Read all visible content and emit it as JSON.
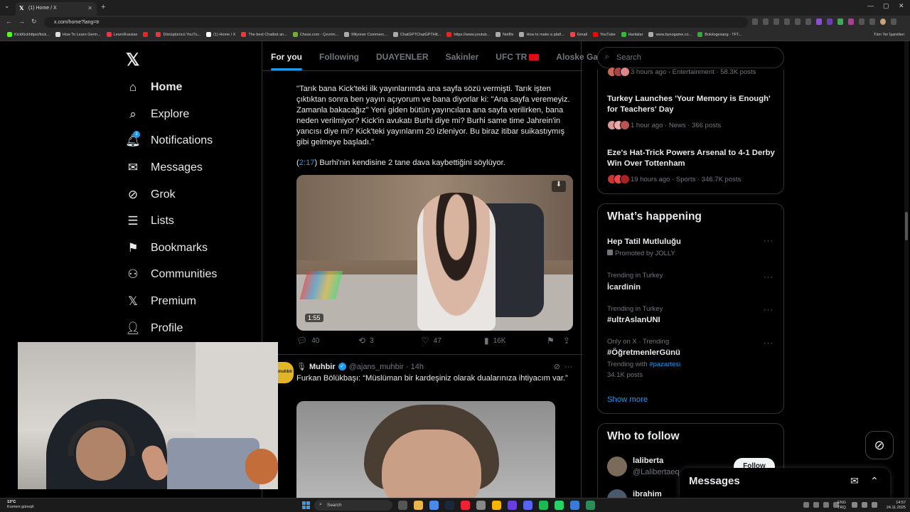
{
  "browser": {
    "tab_title": "(1) Home / X",
    "url": "x.com/home?lang=tr",
    "bookmarks": [
      "KickKickhttps//kick...",
      "How To Learn Germ...",
      "LearnRussian",
      "",
      "Dönüştürücü YouTu...",
      "(1) Home / X",
      "The best Chatbot an...",
      "Chess.com - Çevrim...",
      "Milyoner Commerc...",
      "ChatGPTChatGPTHtt...",
      "https://www.youtub...",
      "Netflix",
      "How to make a platf...",
      "Gmail",
      "YouTube",
      "Haritalar",
      "www.bynogame.co...",
      "Bolologesang - TFT..."
    ],
    "bookmarks_right": "Tüm Yer İşaretleri"
  },
  "sidebar": {
    "items": [
      {
        "label": "Home",
        "icon": "home-icon"
      },
      {
        "label": "Explore",
        "icon": "search-icon"
      },
      {
        "label": "Notifications",
        "icon": "bell-icon"
      },
      {
        "label": "Messages",
        "icon": "envelope-icon"
      },
      {
        "label": "Grok",
        "icon": "grok-icon"
      },
      {
        "label": "Lists",
        "icon": "list-icon"
      },
      {
        "label": "Bookmarks",
        "icon": "bookmark-icon"
      },
      {
        "label": "Communities",
        "icon": "people-icon"
      },
      {
        "label": "Premium",
        "icon": "x-logo-icon"
      },
      {
        "label": "Profile",
        "icon": "person-icon"
      }
    ],
    "notification_count": "1"
  },
  "timeline": {
    "tabs": [
      "For you",
      "Following",
      "DUAYENLER",
      "Sakinler",
      "UFC TR",
      "Aloske Gang"
    ],
    "tweet1": {
      "text": "\"Tarık bana Kick'teki ilk yayınlarımda ana sayfa sözü vermişti. Tarık işten çıktıktan sonra ben yayın açıyorum ve bana diyorlar ki: \"Ana sayfa veremeyiz. Zamanla bakacağız\" Yeni giden bütün yayıncılara ana sayfa verilirken, bana neden verilmiyor? Kick'in avukatı Burhi diye mi? Burhi same time Jahrein'in yancısı diye mi? Kick'teki yayınlarım 20 izleniyor. Bu biraz itibar suikastıymış gibi gelmeye başladı.\"",
      "timestamp_link": "2:17",
      "text2": ") Burhi'nin kendisine 2 tane dava kaybettiğini söylüyor.",
      "video_duration": "1:55",
      "replies": "40",
      "reposts": "3",
      "likes": "47",
      "views": "16K"
    },
    "tweet2": {
      "avatar_text": "muhbir",
      "name": "Muhbir",
      "handle": "@ajans_muhbir",
      "time": "14h",
      "text": "Furkan Bölükbaşı: “Müslüman bir kardeşiniz olarak dualarınıza ihtiyacım var.”"
    }
  },
  "right": {
    "search_placeholder": "Search",
    "news_top_meta": "3 hours ago · Entertainment · 58.3K posts",
    "news": [
      {
        "title": "Turkey Launches 'Your Memory is Enough' for Teachers' Day",
        "meta": "1 hour ago · News · 366 posts"
      },
      {
        "title": "Eze's Hat-Trick Powers Arsenal to 4-1 Derby Win Over Tottenham",
        "meta": "19 hours ago · Sports · 346.7K posts"
      }
    ],
    "whats_happening": {
      "heading": "What’s happening",
      "trends": [
        {
          "context": "",
          "name": "Hep Tatil Mutluluğu",
          "extra": "Promoted by JOLLY"
        },
        {
          "context": "Trending in Turkey",
          "name": "İcardinin",
          "extra": ""
        },
        {
          "context": "Trending in Turkey",
          "name": "#ultrAslanUNI",
          "extra": ""
        },
        {
          "context": "Only on X · Trending",
          "name": "#ÖğretmenlerGünü",
          "extra": "34.1K posts"
        }
      ],
      "trending_with_label": "Trending with",
      "trending_with_tag": "#pazartesi",
      "show_more": "Show more"
    },
    "who_to_follow": {
      "heading": "Who to follow",
      "users": [
        {
          "name": "laliberta",
          "handle": "@Lalibertaeq"
        },
        {
          "name": "ibrahim",
          "handle": ""
        }
      ],
      "follow_label": "Follow"
    }
  },
  "messages_drawer": {
    "title": "Messages"
  },
  "taskbar": {
    "weather_temp": "13°C",
    "weather_desc": "Kısmen güneşli",
    "search": "Search",
    "lang1": "ENG",
    "lang2": "TRQ",
    "time": "14:57",
    "date": "24.11.2025"
  }
}
